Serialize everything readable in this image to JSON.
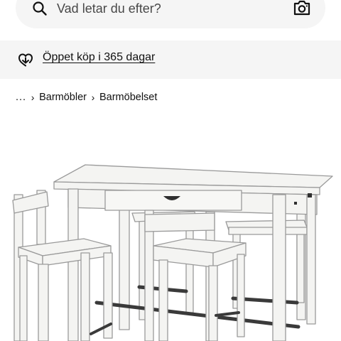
{
  "search": {
    "placeholder": "Vad letar du efter?",
    "value": ""
  },
  "icons": {
    "search": "search-icon",
    "camera": "camera-icon",
    "return": "return-loop-icon",
    "favourite": "heart-icon",
    "breadcrumb_separator": "chevron-right-icon"
  },
  "promo": {
    "label": "Öppet köp i 365 dagar"
  },
  "breadcrumb": {
    "ellipsis": "...",
    "separator": "›",
    "items": [
      {
        "label": "Barmöbler"
      },
      {
        "label": "Barmöbelset"
      }
    ]
  },
  "colors": {
    "surface": "#f5f5f5",
    "text": "#111111",
    "muted_text": "#484848",
    "product_white": "#f4f4f2",
    "footrest": "#3a3a3a"
  }
}
